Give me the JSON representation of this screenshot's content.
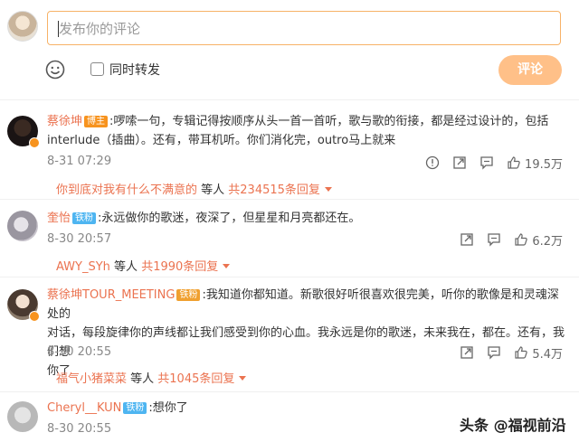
{
  "compose": {
    "placeholder": "发布你的评论",
    "repost_label": "同时转发",
    "submit_label": "评论"
  },
  "comments": [
    {
      "user": "蔡徐坤",
      "tag": "博主",
      "text_line1": ":啰嗦一句，专辑记得按顺序从头一首一首听，歌与歌的衔接，都是经过设计的，包括",
      "text_line2": "interlude（插曲）。还有，带耳机听。你们消化完，outro马上就来",
      "time": "8-31 07:29",
      "likes": "19.5万",
      "reply_user": "你到底对我有什么不满意的",
      "reply_mid": " 等人 ",
      "reply_count": "共234515条回复"
    },
    {
      "user": "奎怡",
      "tag": "铁粉",
      "text_line1": ":永远做你的歌迷，夜深了，但星星和月亮都还在。",
      "time": "8-30 20:57",
      "likes": "6.2万",
      "reply_user": "AWY_SYh",
      "reply_mid": " 等人 ",
      "reply_count": "共1990条回复"
    },
    {
      "user": "蔡徐坤TOUR_MEETING",
      "tag": "铁粉",
      "text_line1": ":我知道你都知道。新歌很好听很喜欢很完美，听你的歌像是和灵魂深处的",
      "text_line2": "对话，每段旋律你的声线都让我们感受到你的心血。我永远是你的歌迷，未来我在，都在。还有，我们想",
      "text_line3": "你了",
      "time": "8-30 20:55",
      "likes": "5.4万",
      "reply_user": "福气小猪菜菜",
      "reply_mid": " 等人 ",
      "reply_count": "共1045条回复"
    },
    {
      "user": "Cheryl__KUN",
      "tag": "铁粉",
      "text_line1": ":想你了",
      "time": "8-30 20:55"
    }
  ],
  "watermark": "头条 @福视前沿",
  "colors": {
    "accent": "#eb7350",
    "submit_bg": "#ffc088",
    "input_border": "#f7b267",
    "fan_tag": "#4eb5f1"
  },
  "icons": [
    "emoji-icon",
    "report-icon",
    "repost-icon",
    "comment-icon",
    "like-icon"
  ]
}
